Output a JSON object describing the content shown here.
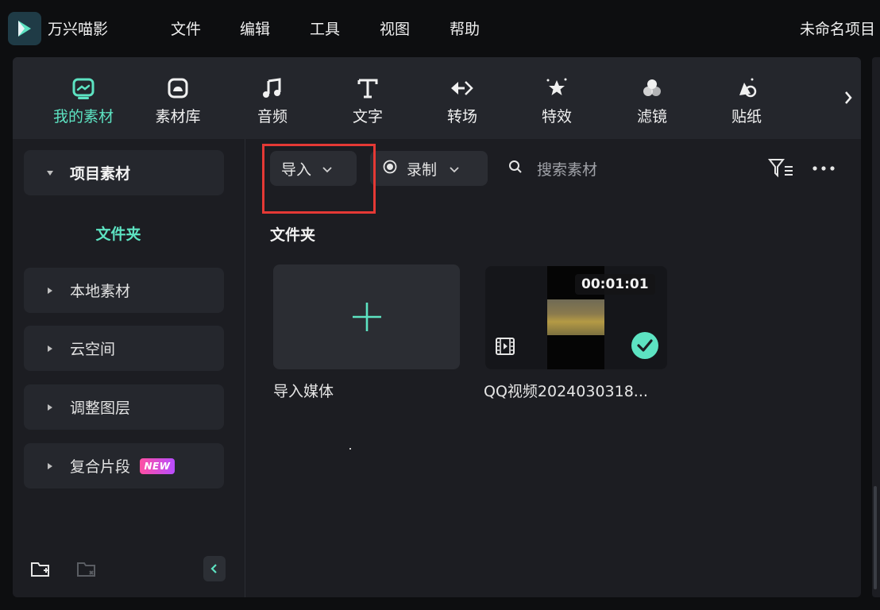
{
  "app": {
    "name": "万兴喵影",
    "logo_icon": "filmora-logo-icon",
    "accent": "#5de3c2"
  },
  "menu": [
    "文件",
    "编辑",
    "工具",
    "视图",
    "帮助"
  ],
  "project": {
    "name": "未命名项目"
  },
  "toolbar": {
    "tools": [
      {
        "label": "我的素材",
        "icon": "my-media-icon",
        "active": true
      },
      {
        "label": "素材库",
        "icon": "stock-library-icon",
        "active": false
      },
      {
        "label": "音频",
        "icon": "music-note-icon",
        "active": false
      },
      {
        "label": "文字",
        "icon": "text-t-icon",
        "active": false
      },
      {
        "label": "转场",
        "icon": "transition-icon",
        "active": false
      },
      {
        "label": "特效",
        "icon": "effects-icon",
        "active": false
      },
      {
        "label": "滤镜",
        "icon": "filter-circles-icon",
        "active": false
      },
      {
        "label": "贴纸",
        "icon": "sticker-icon",
        "active": false
      }
    ]
  },
  "sidebar": {
    "sections": [
      {
        "label": "项目素材",
        "expanded": true
      },
      {
        "label": "本地素材",
        "expanded": false
      },
      {
        "label": "云空间",
        "expanded": false
      },
      {
        "label": "调整图层",
        "expanded": false
      },
      {
        "label": "复合片段",
        "expanded": false,
        "badge": "NEW"
      }
    ],
    "folder_label": "文件夹"
  },
  "content": {
    "import_label": "导入",
    "record_label": "录制",
    "search_placeholder": "搜索素材",
    "section_title": "文件夹",
    "tiles": [
      {
        "label": "导入媒体",
        "type": "add"
      },
      {
        "label": "QQ视频2024030318...",
        "type": "video",
        "duration": "00:01:01",
        "selected": true
      }
    ]
  }
}
